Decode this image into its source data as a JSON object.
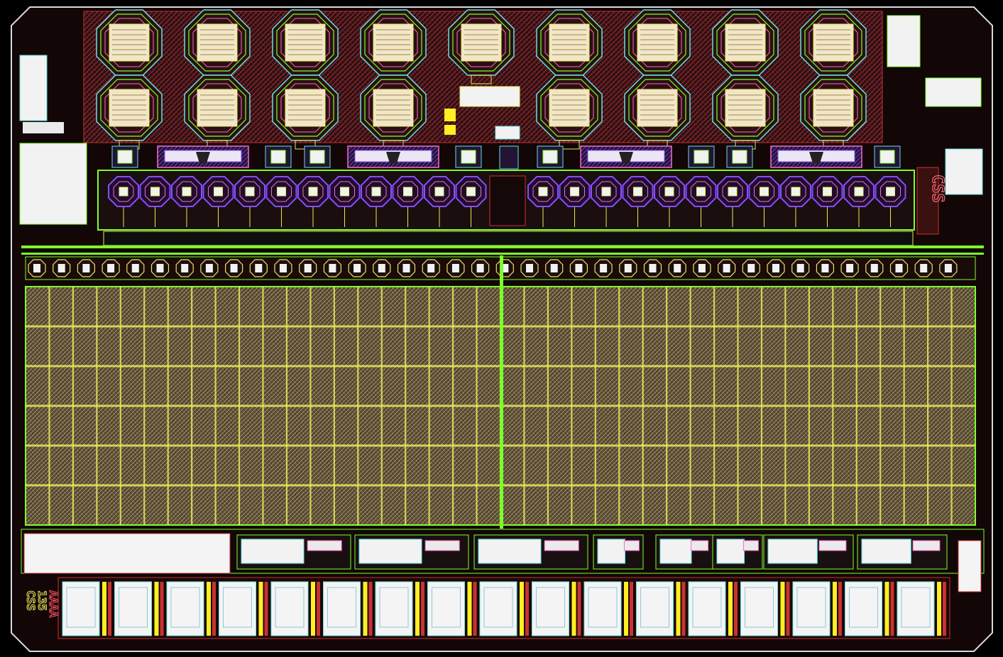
{
  "image": {
    "description_free": true,
    "background": "#000000"
  },
  "colors": {
    "boundary": "#d8d8d8",
    "metal_green": "#7dff2a",
    "metal_yellow": "#e8e85a",
    "metal_red": "#c83232",
    "metal_pink": "#ff66cc",
    "metal_purple": "#8a4cff",
    "metal_cyan": "#66e0e0",
    "fill_brown": "#6b5a3a",
    "fill_dark": "#2a1a12",
    "white_block": "#f2f2f2"
  },
  "layout_counts": {
    "pad_rows_top": 2,
    "pads_top_row": 9,
    "pads_second_row": 8,
    "purple_cells_per_side": 12,
    "small_pads": 38,
    "array_columns": 40,
    "array_rows": 6,
    "bottom_blocks": 17
  },
  "markings": {
    "logo_right": "CSS",
    "logo_left": "CSS",
    "block_number": "135",
    "block_letters": "AAAA"
  },
  "icons": {
    "pad": "octagon-pad-icon",
    "cell": "pixel-cell-icon",
    "logo": "logo-mark-icon"
  }
}
